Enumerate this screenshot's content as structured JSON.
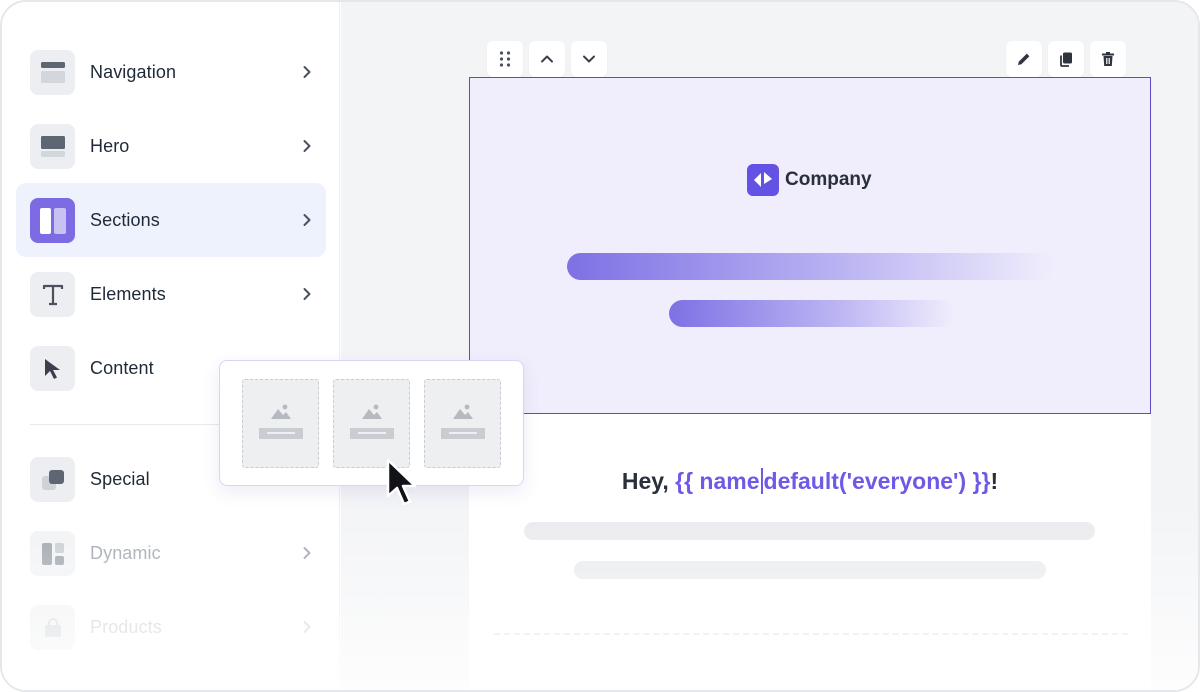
{
  "sidebar": {
    "items": [
      {
        "label": "Navigation",
        "icon": "navigation-icon"
      },
      {
        "label": "Hero",
        "icon": "hero-icon"
      },
      {
        "label": "Sections",
        "icon": "sections-icon",
        "active": true
      },
      {
        "label": "Elements",
        "icon": "text-t-icon"
      },
      {
        "label": "Content",
        "icon": "cursor-arrow-icon"
      },
      {
        "label": "Special",
        "icon": "layers-icon"
      },
      {
        "label": "Dynamic",
        "icon": "dynamic-grid-icon"
      },
      {
        "label": "Products",
        "icon": "shopping-bag-icon"
      }
    ]
  },
  "toolbar": {
    "left": [
      "drag-handle-icon",
      "arrow-up-icon",
      "arrow-down-icon"
    ],
    "right": [
      "edit-pencil-icon",
      "duplicate-icon",
      "delete-trash-icon"
    ]
  },
  "email": {
    "brand_name": "Company",
    "greeting_prefix": "Hey, ",
    "greeting_var_open": "{{ name",
    "greeting_var_close": "default('everyone') }}",
    "greeting_suffix": "!"
  },
  "colors": {
    "accent": "#6352e4",
    "hero_bg": "#f0eefc",
    "active_item_bg": "#eef2fd"
  }
}
